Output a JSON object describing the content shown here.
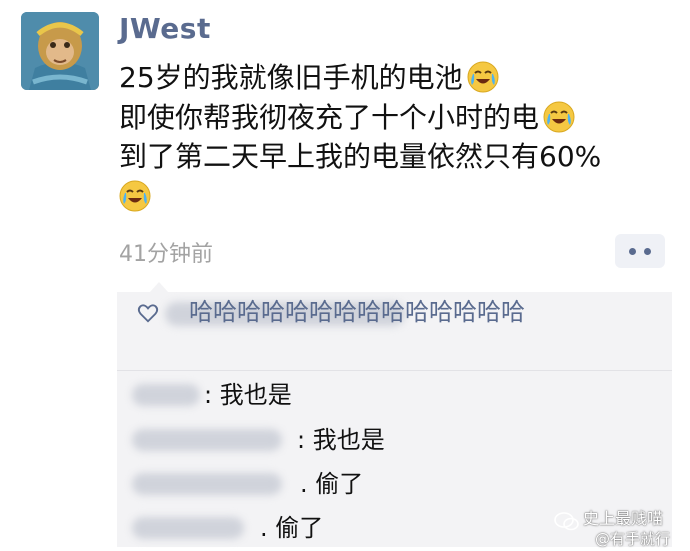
{
  "post": {
    "author": "JWest",
    "lines": [
      "25岁的我就像旧手机的电池",
      "即使你帮我彻夜充了十个小时的电",
      "到了第二天早上我的电量依然只有60%"
    ],
    "emoji_icon": "crying-laughing-face-icon",
    "timestamp": "41分钟前"
  },
  "likes": {
    "visible_text": "哈哈哈哈哈哈哈哈哈哈哈哈哈哈",
    "icon": "heart-outline-icon"
  },
  "comments": [
    {
      "text": ": 我也是"
    },
    {
      "text": ": 我也是"
    },
    {
      "text": ". 偷了"
    },
    {
      "text": ". 偷了"
    }
  ],
  "watermark": {
    "line1": "史上最贱喵",
    "line2": "@有手就行",
    "icon": "wechat-logo-icon"
  },
  "colors": {
    "name_blue": "#5a6b8f",
    "timestamp_gray": "#a3a3a3",
    "comment_bg": "#f3f3f5"
  }
}
